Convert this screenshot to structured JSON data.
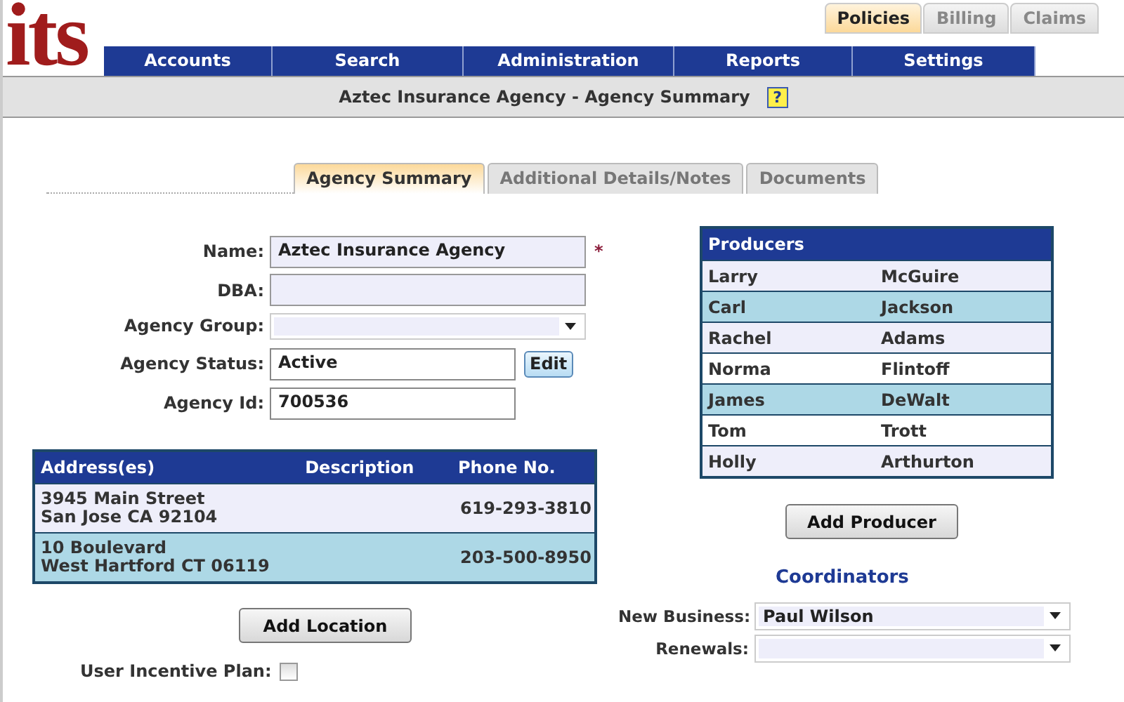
{
  "logo": "its",
  "top_tabs": [
    {
      "label": "Policies",
      "selected": true
    },
    {
      "label": "Billing",
      "selected": false
    },
    {
      "label": "Claims",
      "selected": false
    }
  ],
  "nav": [
    "Accounts",
    "Search",
    "Administration",
    "Reports",
    "Settings"
  ],
  "page_title": "Aztec Insurance Agency - Agency Summary",
  "help": "?",
  "tabs": [
    {
      "label": "Agency Summary",
      "selected": true
    },
    {
      "label": "Additional Details/Notes",
      "selected": false
    },
    {
      "label": "Documents",
      "selected": false
    }
  ],
  "form": [
    {
      "kind": "text",
      "label": "Name:",
      "value": "Aztec Insurance Agency",
      "required": true,
      "marker": "*"
    },
    {
      "kind": "text",
      "label": "DBA:",
      "required": false
    },
    {
      "kind": "select",
      "label": "Agency Group:"
    },
    {
      "kind": "readonly",
      "label": "Agency Status:",
      "value": "Active",
      "button": "Edit"
    },
    {
      "kind": "readonly",
      "label": "Agency Id:",
      "value": "700536"
    }
  ],
  "addresses": {
    "columns": [
      "Address(es)",
      "Description",
      "Phone No."
    ],
    "rows": [
      {
        "lines": [
          "3945 Main Street",
          "San Jose CA 92104"
        ],
        "phone": "619-293-3810",
        "color": "#eeeefa"
      },
      {
        "lines": [
          "10 Boulevard",
          "West Hartford CT 06119"
        ],
        "phone": "203-500-8950",
        "color": "#add8e6"
      }
    ]
  },
  "add_location": "Add Location",
  "incentive": {
    "label": "User Incentive Plan:",
    "checked": false
  },
  "producers": {
    "title": "Producers",
    "rows": [
      {
        "first": "Larry",
        "last": "McGuire",
        "color": "#eeeefa"
      },
      {
        "first": "Carl",
        "last": "Jackson",
        "color": "#add8e6"
      },
      {
        "first": "Rachel",
        "last": "Adams",
        "color": "#eeeefa"
      },
      {
        "first": "Norma",
        "last": "Flintoff",
        "color": "#ffffff"
      },
      {
        "first": "James",
        "last": "DeWalt",
        "color": "#add8e6"
      },
      {
        "first": "Tom",
        "last": "Trott",
        "color": "#ffffff"
      },
      {
        "first": "Holly",
        "last": "Arthurton",
        "color": "#eeeefa"
      }
    ]
  },
  "add_producer": "Add Producer",
  "coordinators": {
    "title": "Coordinators",
    "fields": [
      {
        "label": "New Business:",
        "value": "Paul Wilson"
      },
      {
        "label": "Renewals:"
      }
    ]
  }
}
